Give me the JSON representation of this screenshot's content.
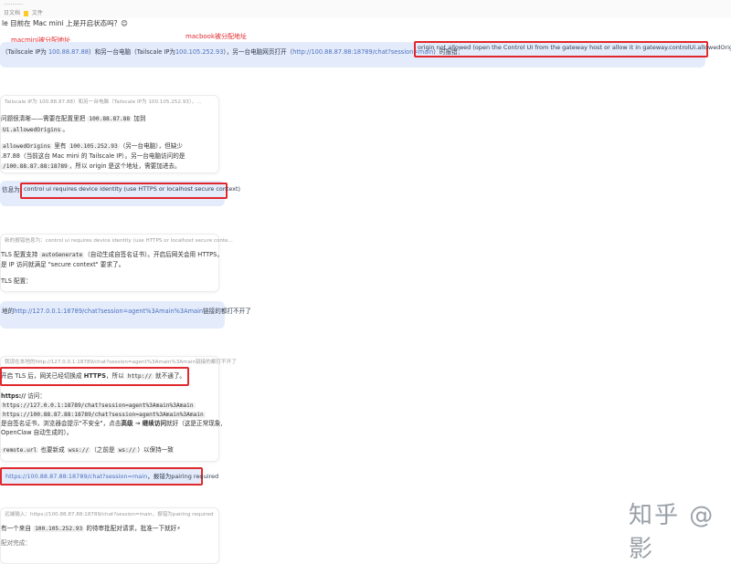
{
  "topbar": {
    "line1": "...........",
    "line2_prefix": "日文档",
    "line2_doc": "文件"
  },
  "question": "le 目前在 Mac mini 上是开启状态吗？😊",
  "annotations": {
    "macmini_label": "macmini被分配地址",
    "macbook_label": "macbook被分配地址"
  },
  "msg1": {
    "prefix": "（Tailscale IP为 ",
    "ip1": "100.88.87.88",
    "mid1": "）和另一台电脑（Tailscale IP为",
    "ip2": "100.105.252.93",
    "mid2": "），另一台电脑网页打开（",
    "url": "http://100.88.87.88:18789/chat?session=main",
    "mid3": "）时报错：",
    "error": "origin not allowed (open the Control UI from the gateway host or allow it in gateway.controlUi.allowedOrigins)"
  },
  "reply1": {
    "head": "Tailscale IP为 100.88.87.88）和另一台电脑（Tailscale IP为 100.105.252.93），...",
    "l1_a": "问题很清晰——需要在配置里把 ",
    "l1_code": "100.88.87.88",
    "l1_b": " 加到",
    "l2_code": "Ui.allowedOrigins",
    "l2_b": "。",
    "l3_code": "allowedOrigins",
    "l3_b": " 里有 ",
    "l3_code2": "100.105.252.93",
    "l3_c": "（另一台电脑），但缺少",
    "l4": ".87.88（当前这台 Mac mini 的 Tailscale IP）。另一台电脑访问的是",
    "l5_code": "/100.88.87.88:18789",
    "l5_b": "，所以 origin 是这个地址，需要加进去。"
  },
  "msg2": {
    "prefix": "信息为：",
    "error": "control ui requires device identity (use HTTPS or localhost secure context)"
  },
  "reply2": {
    "head": "新的报错信息为：control ui requires device identity (use HTTPS or localhost secure conte...",
    "l1_a": "TLS 配置支持 ",
    "l1_code": "autoGenerate",
    "l1_b": "（自动生成自签名证书）。开启后网关会用 HTTPS，",
    "l2": "是 IP 访问就满足 \"secure context\" 要求了。",
    "l3": "TLS 配置："
  },
  "msg3": {
    "prefix": "地的",
    "url": "http://127.0.0.1:18789/chat?session=agent%3Amain%3Amain",
    "suffix": "链接的都打不开了"
  },
  "reply3": {
    "head": "我现在本地的http://127.0.0.1:18789/chat?session=agent%3Amain%3Amain链接的都打不开了",
    "l1_a": "开启 TLS 后，网关已经切换成 ",
    "l1_bold": "HTTPS",
    "l1_b": "，所以 ",
    "l1_code": "http://",
    "l1_c": " 就不通了。",
    "l2_bold": "https://",
    "l2_b": " 访问：",
    "l3_code": "https://127.0.0.1:18789/chat?session=agent%3Amain%3Amain",
    "l4_code": "https://100.88.87.88:18789/chat?session=agent%3Amain%3Amain",
    "l5_a": "是自签名证书，浏览器会提示\"不安全\"，点击",
    "l5_bold": "高级 → 继续访问",
    "l5_b": "就好（这是正常现象,",
    "l6": "OpenClaw 自动生成的）。",
    "l7_code": "remote.url",
    "l7_b": " 也要新成 ",
    "l7_code2": "wss://",
    "l7_c": "（之前是 ",
    "l7_code3": "ws://",
    "l7_d": "）以保持一致"
  },
  "msg4": {
    "url": "https://100.88.87.88:18789/chat?session=main",
    "suffix": "，报错为pairing required"
  },
  "reply4": {
    "head": "远端输入：https://100.88.87.88:18789/chat?session=main，报错为pairing required",
    "l1_a": "有一个来自 ",
    "l1_code": "100.105.252.93",
    "l1_b": " 的待审批配对请求，批准一下就好⚡",
    "l2": "配对完成："
  },
  "watermark": "知乎 @影"
}
